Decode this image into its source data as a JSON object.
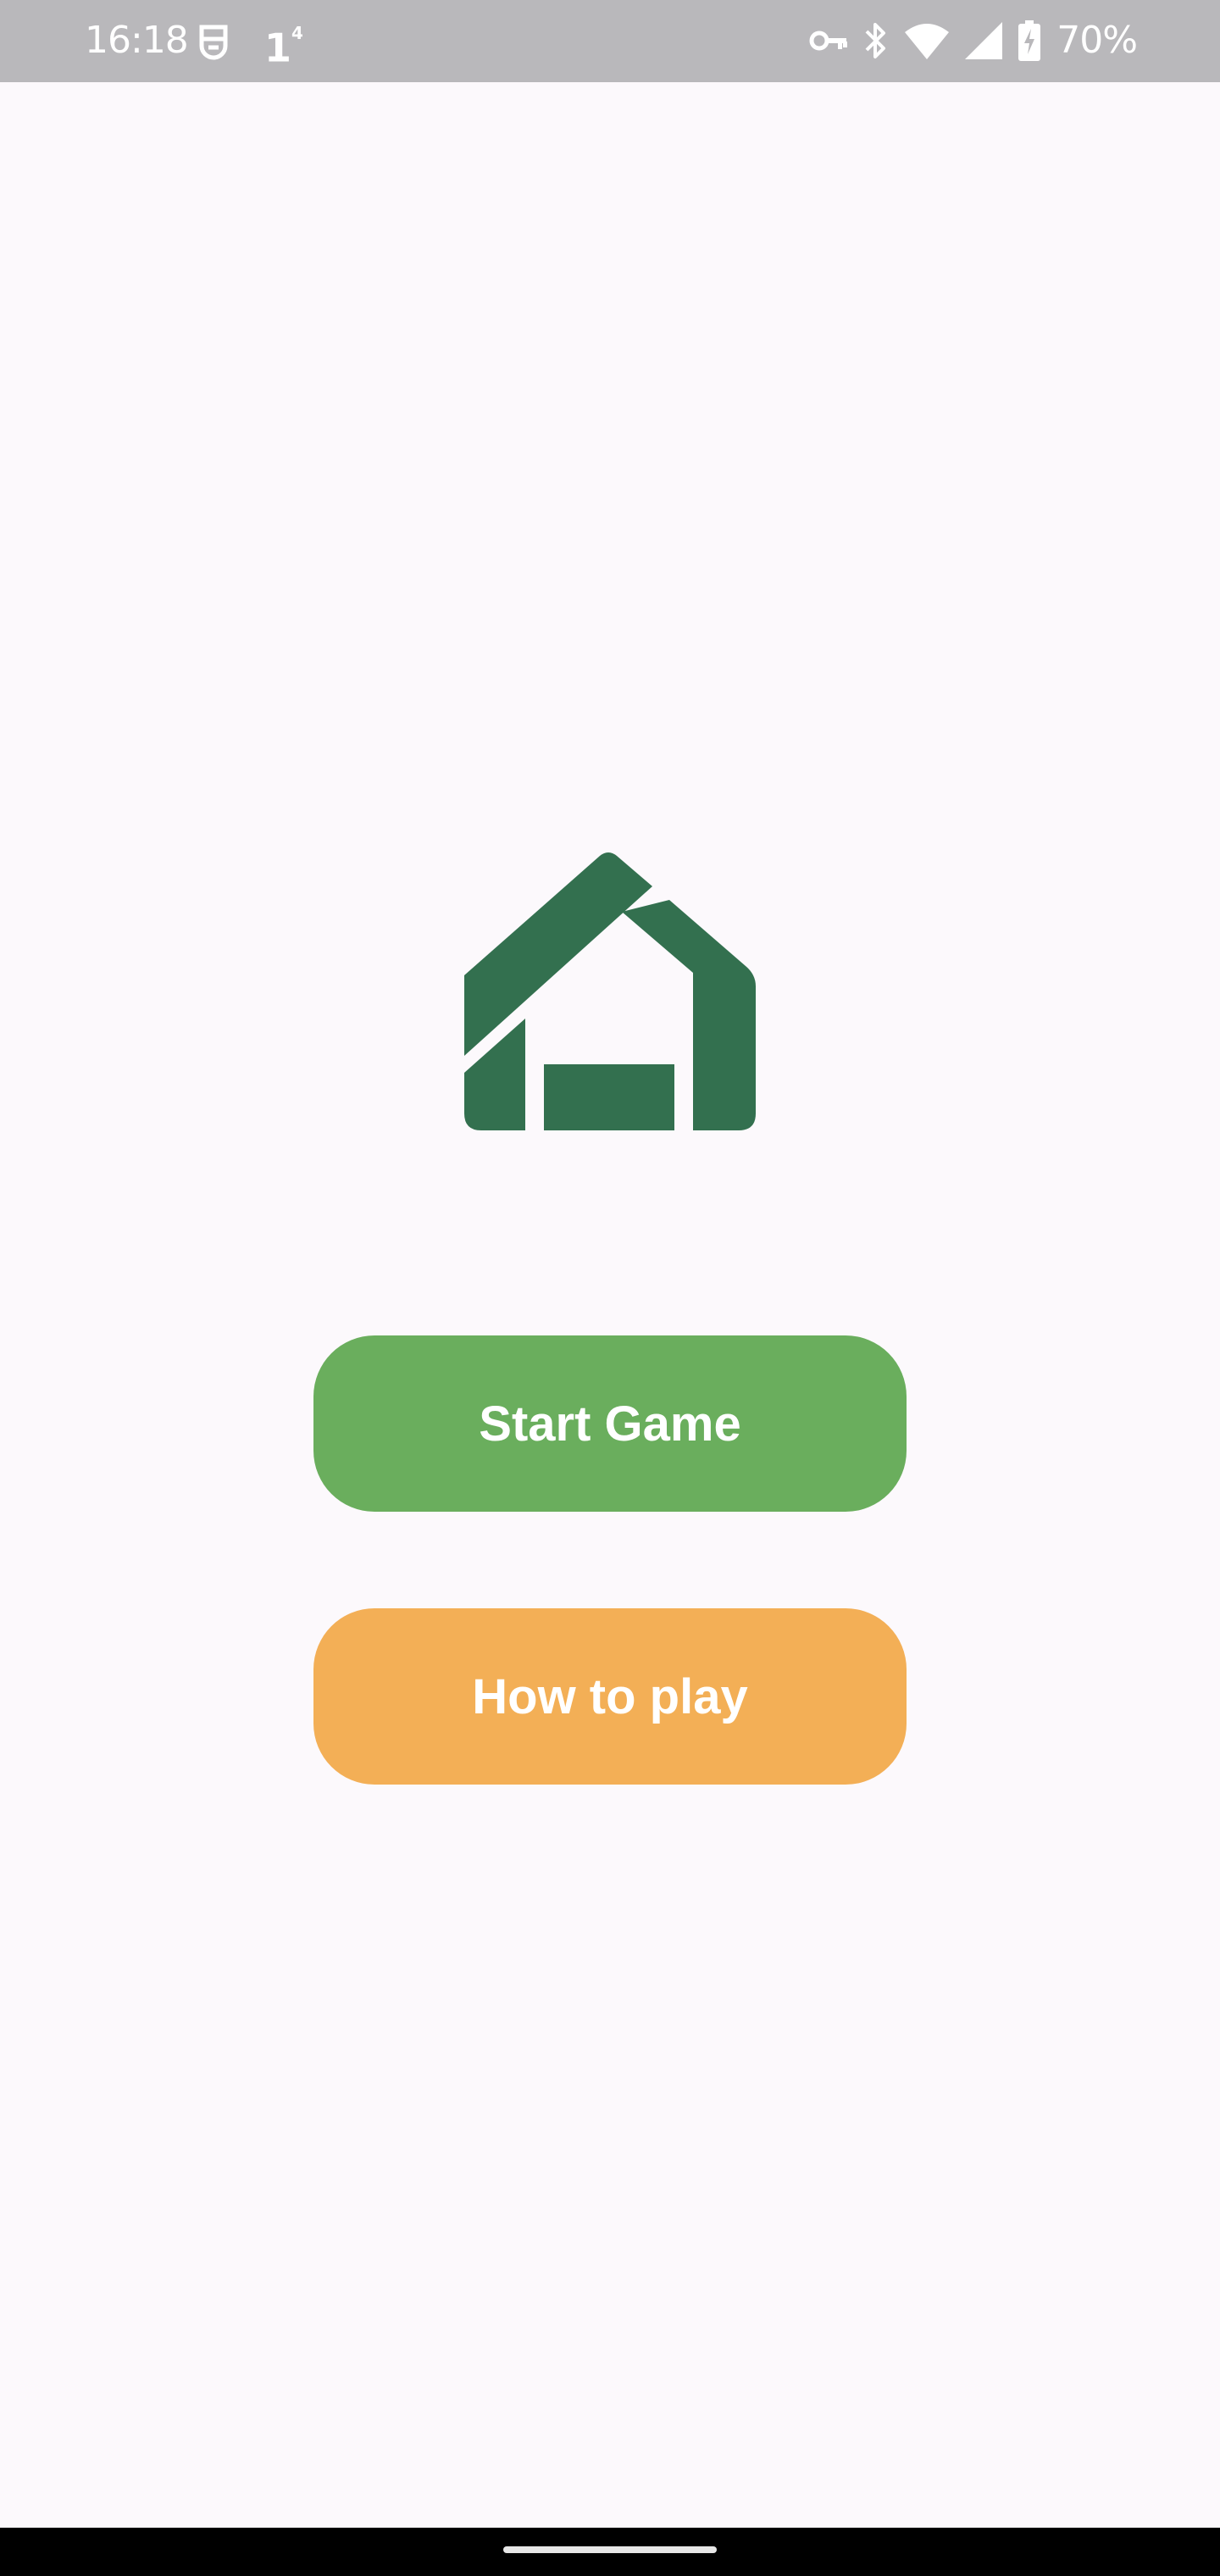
{
  "status_bar": {
    "time": "16:18",
    "battery_percent": "70%",
    "icons": [
      "face-icon",
      "notification-count-icon",
      "vpn-key-icon",
      "bluetooth-icon",
      "wifi-icon",
      "cell-signal-icon",
      "battery-charging-icon"
    ],
    "notification_count": "1",
    "notification_superscript": "4"
  },
  "main": {
    "logo_icon": "house-logo-icon",
    "logo_color": "#33704f",
    "buttons": {
      "start_label": "Start Game",
      "howto_label": "How to play"
    },
    "colors": {
      "start": "#6aae5d",
      "howto": "#f3af56",
      "background": "#fcf9fc"
    }
  }
}
